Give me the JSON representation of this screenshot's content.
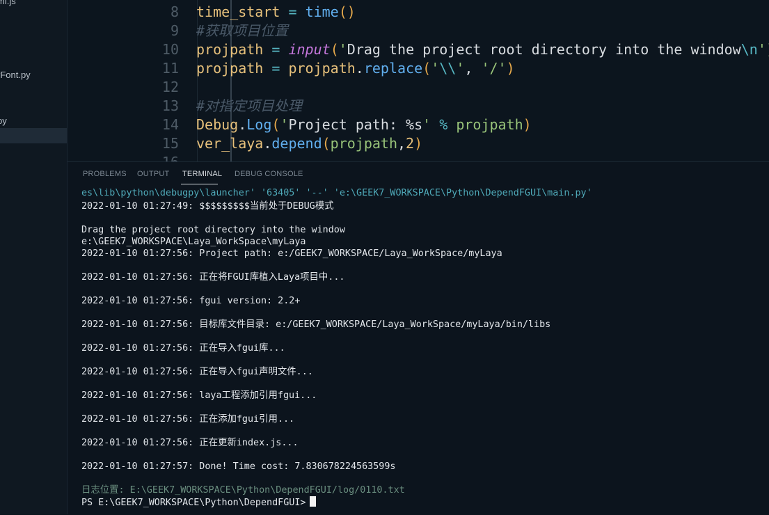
{
  "sidebar": {
    "files": [
      "mi.js",
      "rFont.py",
      "py"
    ]
  },
  "editor": {
    "lines": [
      {
        "num": "8",
        "tokens": [
          {
            "t": "time_start",
            "c": "v"
          },
          {
            "t": " ",
            "c": "s"
          },
          {
            "t": "=",
            "c": "o"
          },
          {
            "t": " ",
            "c": "s"
          },
          {
            "t": "time",
            "c": "f"
          },
          {
            "t": "()",
            "c": "p"
          }
        ]
      },
      {
        "num": "9",
        "tokens": [
          {
            "t": "#获取项目位置",
            "c": "c"
          }
        ]
      },
      {
        "num": "10",
        "tokens": [
          {
            "t": "projpath",
            "c": "v"
          },
          {
            "t": " ",
            "c": "s"
          },
          {
            "t": "=",
            "c": "o"
          },
          {
            "t": " ",
            "c": "s"
          },
          {
            "t": "input",
            "c": "it"
          },
          {
            "t": "(",
            "c": "p"
          },
          {
            "t": "'",
            "c": "st"
          },
          {
            "t": "Drag the project root directory into the window",
            "c": "s"
          },
          {
            "t": "\\n",
            "c": "e"
          },
          {
            "t": "')",
            "c": "st"
          }
        ]
      },
      {
        "num": "11",
        "tokens": [
          {
            "t": "projpath",
            "c": "v"
          },
          {
            "t": " ",
            "c": "s"
          },
          {
            "t": "=",
            "c": "o"
          },
          {
            "t": " ",
            "c": "s"
          },
          {
            "t": "projpath",
            "c": "v"
          },
          {
            "t": ".",
            "c": "s"
          },
          {
            "t": "replace",
            "c": "f"
          },
          {
            "t": "(",
            "c": "p"
          },
          {
            "t": "'",
            "c": "st"
          },
          {
            "t": "\\\\",
            "c": "e"
          },
          {
            "t": "'",
            "c": "st"
          },
          {
            "t": ", ",
            "c": "s"
          },
          {
            "t": "'/'",
            "c": "st"
          },
          {
            "t": ")",
            "c": "p"
          }
        ]
      },
      {
        "num": "12",
        "tokens": []
      },
      {
        "num": "13",
        "tokens": [
          {
            "t": "#对指定项目处理",
            "c": "c"
          }
        ]
      },
      {
        "num": "14",
        "tokens": [
          {
            "t": "Debug",
            "c": "v"
          },
          {
            "t": ".",
            "c": "s"
          },
          {
            "t": "Log",
            "c": "f"
          },
          {
            "t": "(",
            "c": "p"
          },
          {
            "t": "'",
            "c": "st"
          },
          {
            "t": "Project path: %s",
            "c": "s"
          },
          {
            "t": "'",
            "c": "st"
          },
          {
            "t": " ",
            "c": "s"
          },
          {
            "t": "%",
            "c": "o"
          },
          {
            "t": " ",
            "c": "s"
          },
          {
            "t": "projpath",
            "c": "st"
          },
          {
            "t": ")",
            "c": "p"
          }
        ]
      },
      {
        "num": "15",
        "tokens": [
          {
            "t": "ver_laya",
            "c": "v"
          },
          {
            "t": ".",
            "c": "s"
          },
          {
            "t": "depend",
            "c": "f"
          },
          {
            "t": "(",
            "c": "p"
          },
          {
            "t": "projpath",
            "c": "st"
          },
          {
            "t": ",",
            "c": "s"
          },
          {
            "t": "2",
            "c": "v"
          },
          {
            "t": ")",
            "c": "p"
          }
        ]
      },
      {
        "num": "16",
        "tokens": []
      }
    ]
  },
  "panel": {
    "tabs": [
      {
        "label": "PROBLEMS"
      },
      {
        "label": "OUTPUT"
      },
      {
        "label": "TERMINAL"
      },
      {
        "label": "DEBUG CONSOLE"
      }
    ],
    "terminal_lines": [
      {
        "text": "es\\lib\\python\\debugpy\\launcher' '63405' '--' 'e:\\GEEK7_WORKSPACE\\Python\\DependFGUI\\main.py'",
        "kind": "cmd"
      },
      {
        "text": "2022-01-10 01:27:49: $$$$$$$$$当前处于DEBUG模式",
        "kind": "out"
      },
      {
        "text": "Drag the project root directory into the window",
        "kind": "out"
      },
      {
        "text": "e:\\GEEK7_WORKSPACE\\Laya_WorkSpace\\myLaya",
        "kind": "out"
      },
      {
        "text": "2022-01-10 01:27:56: Project path: e:/GEEK7_WORKSPACE/Laya_WorkSpace/myLaya",
        "kind": "out"
      },
      {
        "text": "2022-01-10 01:27:56: 正在将FGUI库植入Laya项目中...",
        "kind": "out"
      },
      {
        "text": "2022-01-10 01:27:56: fgui version: 2.2+",
        "kind": "out"
      },
      {
        "text": "2022-01-10 01:27:56: 目标库文件目录: e:/GEEK7_WORKSPACE/Laya_WorkSpace/myLaya/bin/libs",
        "kind": "out"
      },
      {
        "text": "2022-01-10 01:27:56: 正在导入fgui库...",
        "kind": "out"
      },
      {
        "text": "2022-01-10 01:27:56: 正在导入fgui声明文件...",
        "kind": "out"
      },
      {
        "text": "2022-01-10 01:27:56: laya工程添加引用fgui...",
        "kind": "out"
      },
      {
        "text": "2022-01-10 01:27:56: 正在添加fgui引用...",
        "kind": "out"
      },
      {
        "text": "2022-01-10 01:27:56: 正在更新index.js...",
        "kind": "out"
      },
      {
        "text": "2022-01-10 01:27:57: Done! Time cost: 7.830678224563599s",
        "kind": "out"
      },
      {
        "text": "日志位置: E:\\GEEK7_WORKSPACE\\Python\\DependFGUI/log/0110.txt",
        "kind": "log"
      },
      {
        "text": "PS E:\\GEEK7_WORKSPACE\\Python\\DependFGUI>",
        "kind": "prompt"
      }
    ]
  }
}
